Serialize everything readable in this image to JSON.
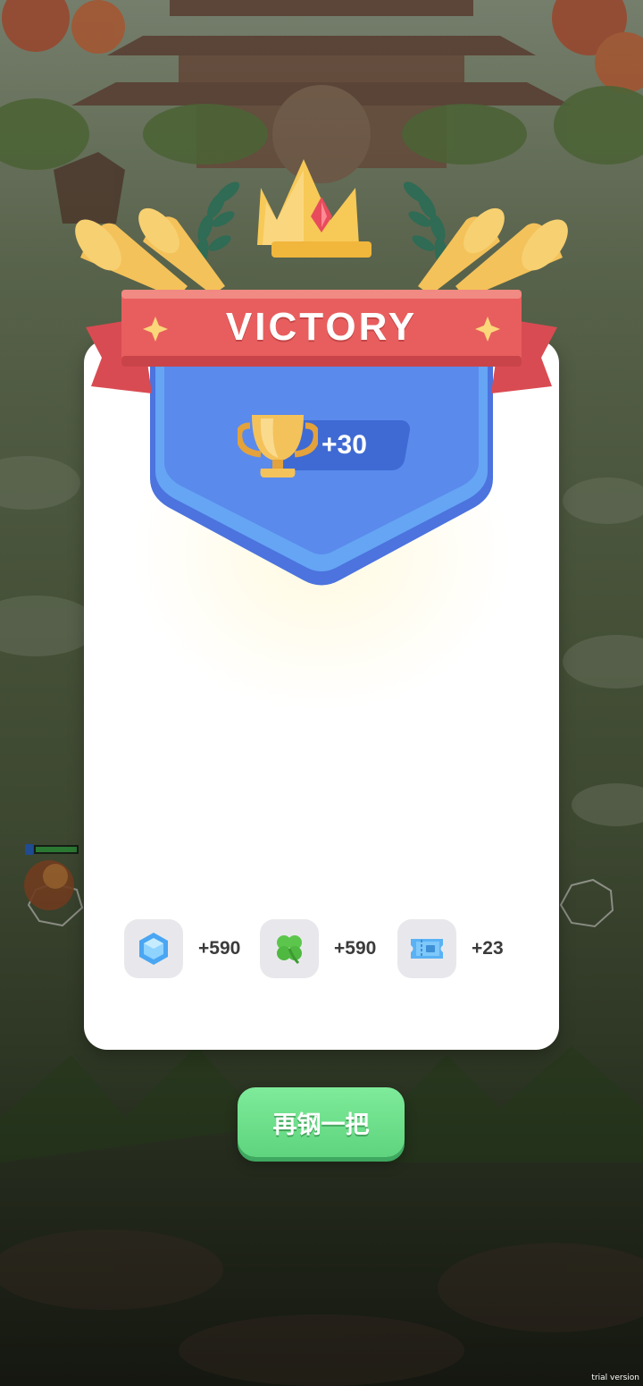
{
  "header": {
    "title": "VICTORY"
  },
  "trophy": {
    "icon": "trophy-icon",
    "amount": "+30"
  },
  "rewards": [
    {
      "icon": "blue-gem-icon",
      "amount": "+590"
    },
    {
      "icon": "four-leaf-clover-icon",
      "amount": "+590"
    },
    {
      "icon": "ticket-icon",
      "amount": "+23"
    }
  ],
  "actions": {
    "play_again_label": "再钢一把"
  },
  "player_unit": {
    "level": "1"
  },
  "watermark": "trial version",
  "colors": {
    "ribbon": "#e85e5e",
    "shield": "#5a86ea",
    "button": "#6fe08c",
    "gold": "#f2b944"
  }
}
